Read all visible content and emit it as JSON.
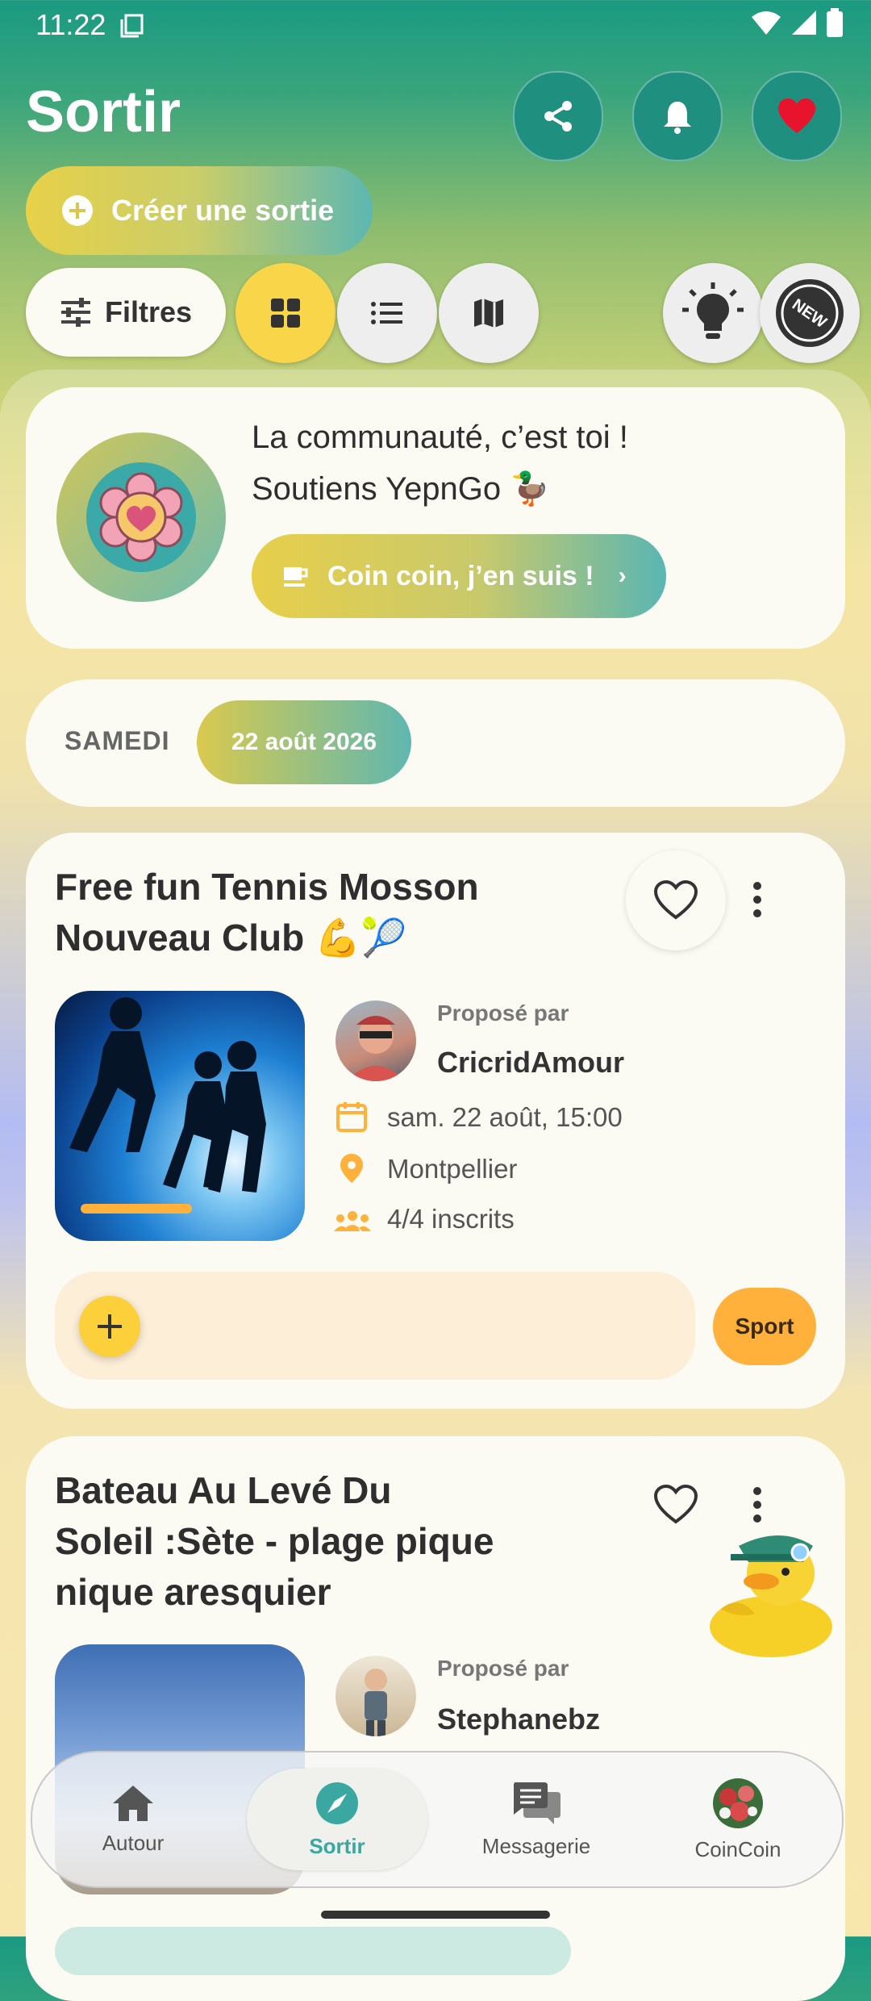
{
  "status": {
    "time": "11:22"
  },
  "header": {
    "title": "Sortir",
    "create_label": "Créer une sortie",
    "filters_label": "Filtres",
    "icons": [
      "share-icon",
      "bell-icon",
      "heart-icon",
      "plus-circle-icon",
      "tune-icon",
      "grid-icon",
      "list-icon",
      "map-icon",
      "lightbulb-icon",
      "new-badge-icon"
    ],
    "colors": {
      "accent_yellow": "#f9d649",
      "teal": "#1f8f80",
      "heart_red": "#e8132c",
      "tag_orange": "#ffb13b"
    }
  },
  "promo": {
    "line1": "La communauté, c’est toi !",
    "line2": "Soutiens YepnGo 🦆",
    "button_label": "Coin coin, j’en suis !"
  },
  "date_header": {
    "day": "SAMEDI",
    "date": "22 août 2026"
  },
  "events": [
    {
      "title_line1": "Free fun Tennis Mosson",
      "title_line2": "Nouveau Club 💪🎾",
      "proposed_by_label": "Proposé par",
      "organizer": "CricridAmour",
      "datetime": "sam. 22 août, 15:00",
      "location": "Montpellier",
      "attendees": "4/4 inscrits",
      "tag": "Sport",
      "progress": 0.45
    },
    {
      "title_line1": "Bateau Au Levé Du",
      "title_line2": "Soleil :Sète -  plage pique",
      "title_line3": "nique aresquier",
      "proposed_by_label": "Proposé par",
      "organizer": "Stephanebz"
    }
  ],
  "nav": [
    {
      "label": "Autour",
      "icon": "home-icon"
    },
    {
      "label": "Sortir",
      "icon": "compass-icon",
      "active": true
    },
    {
      "label": "Messagerie",
      "icon": "chat-icon"
    },
    {
      "label": "CoinCoin",
      "icon": "coincoin-avatar"
    }
  ]
}
